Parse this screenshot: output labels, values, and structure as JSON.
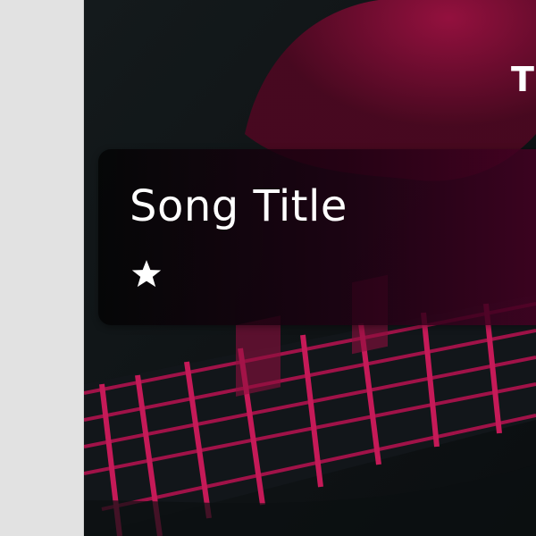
{
  "header": {
    "title_fragment": "T"
  },
  "song_card": {
    "title": "Song Title",
    "favorite_icon": "star-icon",
    "favorited": true
  },
  "colors": {
    "accent": "#b0124e",
    "card_text": "#ffffff",
    "hero_bg": "#0f1316"
  }
}
